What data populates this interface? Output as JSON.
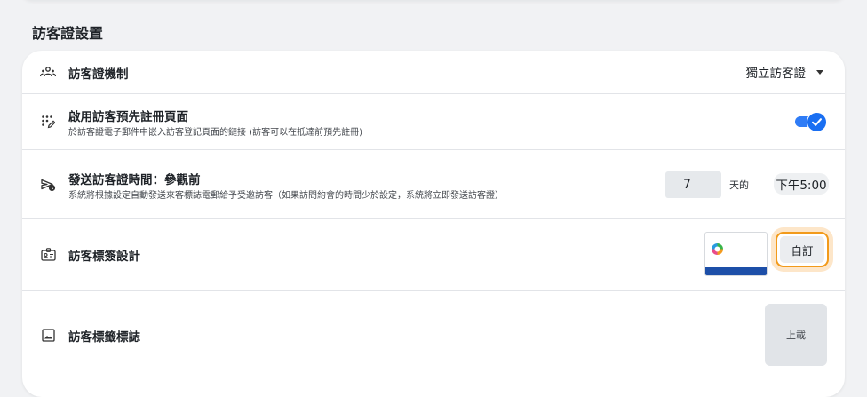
{
  "section": {
    "title": "訪客證設置"
  },
  "rows": {
    "mechanism": {
      "icon": "people-group-icon",
      "title": "訪客證機制",
      "dropdown_value": "獨立訪客證"
    },
    "preregistration": {
      "icon": "dial-pad-edit-icon",
      "title": "啟用訪客預先註冊頁面",
      "description": "於訪客證電子郵件中嵌入訪客登記頁面的鏈接 (訪客可以在抵達前預先註冊)",
      "enabled": true
    },
    "send_time": {
      "icon": "send-clock-icon",
      "title": "發送訪客證時間：參觀前",
      "description": "系統將根據設定自動發送來客標誌電郵給予受邀訪客（如果訪問約會的時間少於設定，系統將立即發送訪客證）",
      "days_value": "7",
      "days_unit": "天的",
      "time_value": "下午5:00"
    },
    "badge_design": {
      "icon": "id-badge-icon",
      "title": "訪客標簽設計",
      "custom_label": "自訂"
    },
    "badge_logo": {
      "icon": "image-icon",
      "title": "訪客標籤標誌",
      "upload_label": "上載"
    }
  },
  "colors": {
    "accent": "#1a6ff2",
    "focus_ring": "#f29a1a",
    "badge_bar": "#1d4fa8"
  }
}
